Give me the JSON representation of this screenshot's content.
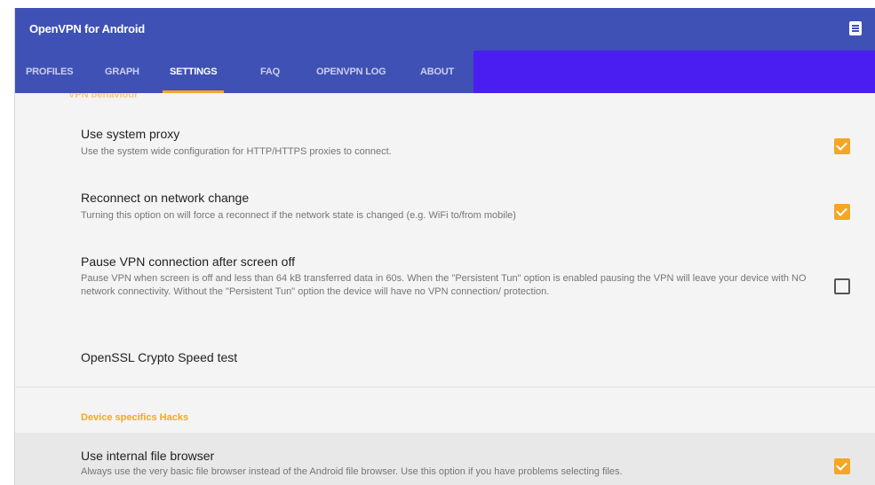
{
  "app": {
    "title": "OpenVPN for Android",
    "menu_icon": "overflow-menu-icon",
    "colors": {
      "appbar": "#3f51b5",
      "tab_extension": "#4a1ef0",
      "accent": "#f5a623"
    }
  },
  "tabs": [
    {
      "label": "PROFILES",
      "active": false
    },
    {
      "label": "GRAPH",
      "active": false
    },
    {
      "label": "SETTINGS",
      "active": true
    },
    {
      "label": "FAQ",
      "active": false
    },
    {
      "label": "OPENVPN LOG",
      "active": false
    },
    {
      "label": "ABOUT",
      "active": false
    }
  ],
  "settings": {
    "partial_header": "VPN behaviour",
    "items": [
      {
        "title": "Use system proxy",
        "summary": "Use the system wide configuration for HTTP/HTTPS proxies to connect.",
        "checked": true
      },
      {
        "title": "Reconnect on network change",
        "summary": "Turning this option on will force a reconnect if the network state is changed (e.g. WiFi to/from mobile)",
        "checked": true
      },
      {
        "title": "Pause VPN connection after screen off",
        "summary": "Pause VPN when screen is off and less than 64 kB transferred data in 60s. When the \"Persistent Tun\" option is enabled pausing the VPN will leave your device with NO network connectivity. Without the \"Persistent Tun\" option the device will have no VPN connection/ protection.",
        "checked": false
      },
      {
        "title": "OpenSSL Crypto Speed test"
      }
    ],
    "device_section": {
      "header": "Device specifics Hacks",
      "items": [
        {
          "title": "Use internal file browser",
          "summary": "Always use the very basic file browser instead of the Android file browser. Use this option if you have problems selecting files.",
          "checked": true
        }
      ]
    }
  }
}
